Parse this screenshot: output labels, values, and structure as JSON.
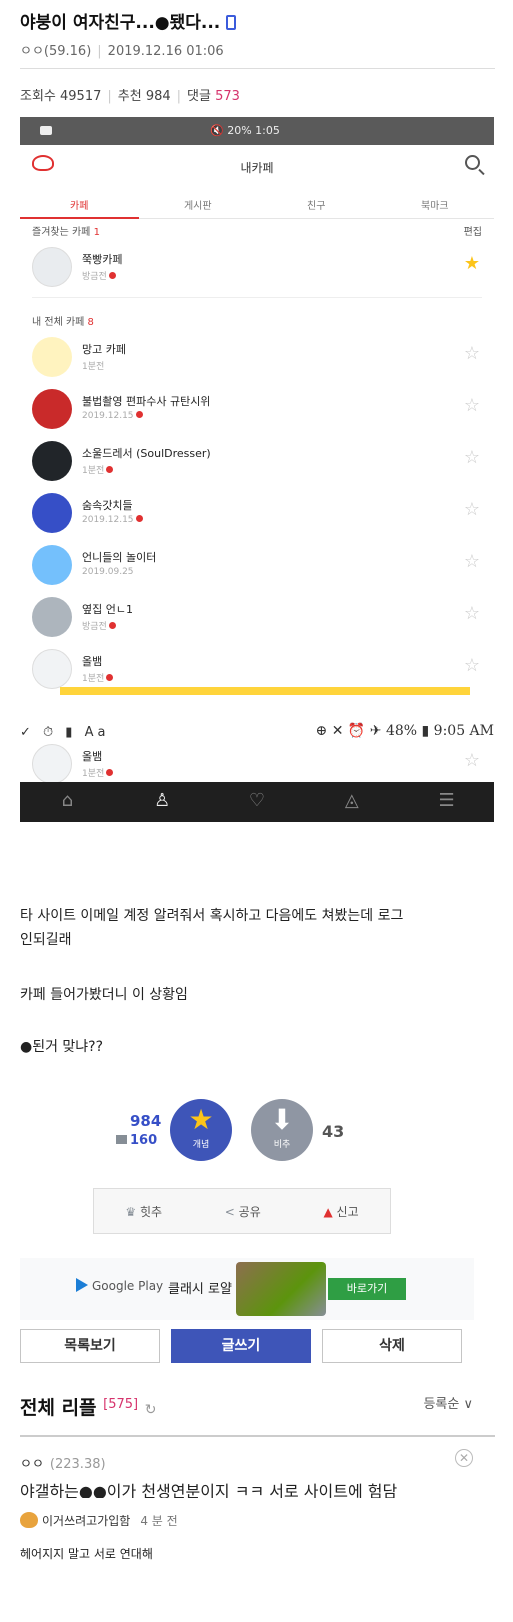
{
  "post": {
    "title": "야붕이 여자친구...●됐다...",
    "author": "ㅇㅇ(59.16)",
    "date": "2019.12.16 01:06",
    "views_label": "조회수 49517",
    "recommend_label": "추천 984",
    "comments_label": "댓글",
    "comments_count": "573"
  },
  "shot1": {
    "status_text": "🔇 20% 1:05",
    "header_title": "내카페",
    "tabs": [
      "카페",
      "게시판",
      "친구",
      "북마크"
    ],
    "favorites_label": "즐겨찾는 카페",
    "favorites_count": "1",
    "edit_label": "편집",
    "favorite_cafe": {
      "name": "쭉빵카페",
      "sub": "방금전"
    },
    "all_label": "내 전체 카페",
    "all_count": "8",
    "cafes": [
      {
        "name": "망고 카페",
        "sub": "1분전"
      },
      {
        "name": "불법촬영 편파수사 규탄시위",
        "sub": "2019.12.15"
      },
      {
        "name": "소울드레서 (SoulDresser)",
        "sub": "1분전"
      },
      {
        "name": "숨속갓치들",
        "sub": "2019.12.15"
      },
      {
        "name": "언니들의 놀이터",
        "sub": "2019.09.25"
      },
      {
        "name": "옆집 언ㄴ1",
        "sub": "방금전"
      },
      {
        "name": "올뱀",
        "sub": "1분전"
      }
    ]
  },
  "shot2": {
    "status_left": "✓ ⏱ ▮ Aa",
    "status_right": "⊕ ✕ ⏰ ✈ 48% ▮ 9:05 AM",
    "cafe": {
      "name": "올뱀",
      "sub": "1분전"
    }
  },
  "body": {
    "line1": "타 사이트 이메일 계정 알려줘서 혹시하고 다음에도 쳐봤는데 로그",
    "line2": "인되길래",
    "line3": "카페 들어가봤더니 이 상황임",
    "line4": "●된거 맞냐??"
  },
  "votes": {
    "up": "984",
    "up_sub": "160",
    "up_label": "개념",
    "down_label": "비추",
    "down": "43"
  },
  "actions": {
    "hit": "힛추",
    "share": "공유",
    "report": "신고"
  },
  "ad": {
    "store": "Google Play",
    "game": "클래시 로얄",
    "cta": "바로가기"
  },
  "buttons": {
    "list": "목록보기",
    "write": "글쓰기",
    "delete": "삭제"
  },
  "comments": {
    "title": "전체 리플",
    "count": "[575]",
    "sort": "등록순",
    "first": {
      "user": "ㅇㅇ",
      "ip": "(223.38)",
      "text": "야갤하는●●이가 천생연분이지 ㅋㅋ 서로 사이트에 험담"
    },
    "second": {
      "user": "이거쓰려고가입함",
      "time": "4 분 전",
      "text": "헤어지지 말고 서로 연대해"
    }
  },
  "colors": {
    "accent_red": "#e03131",
    "brand_blue": "#3e55b8",
    "star": "#fcc419"
  }
}
